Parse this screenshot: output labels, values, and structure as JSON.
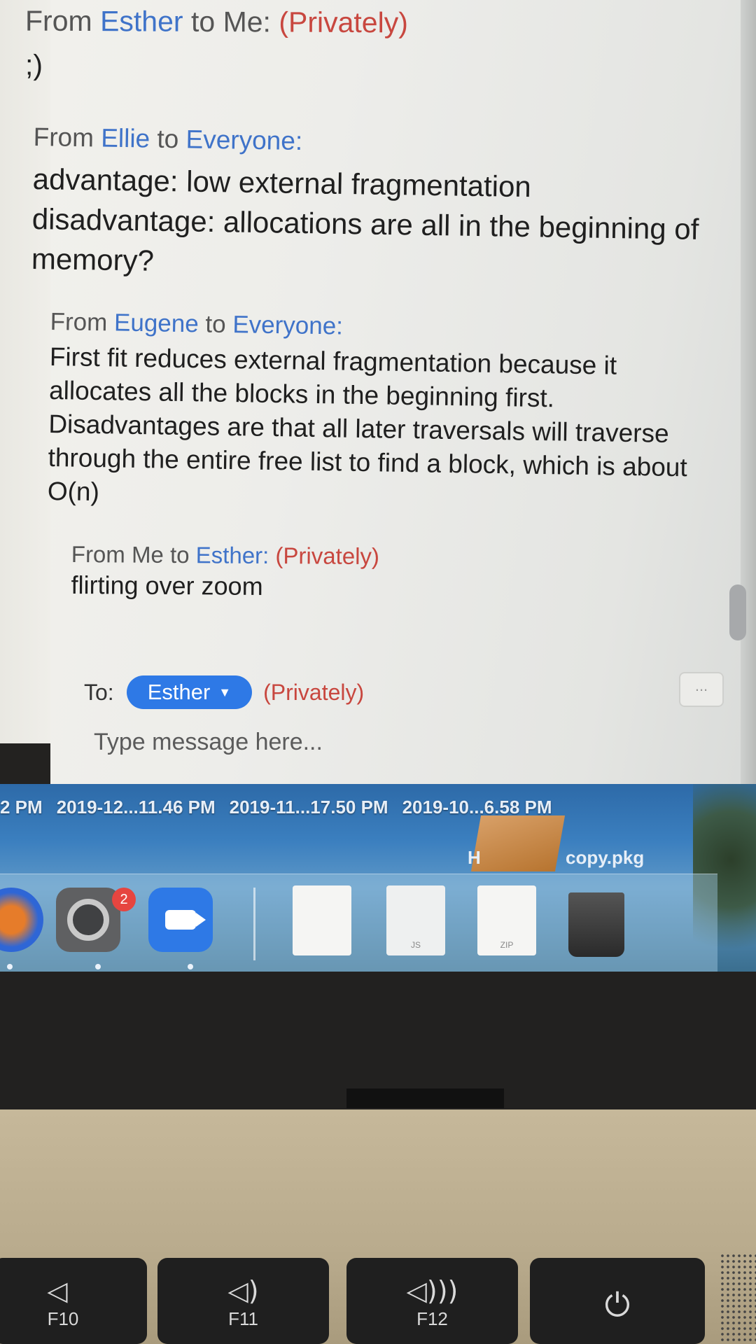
{
  "chat": {
    "messages": [
      {
        "prefix": "From",
        "from": "Esther",
        "mid": "to",
        "to": "Me:",
        "private": "(Privately)",
        "body": ";)"
      },
      {
        "prefix": "From",
        "from": "Ellie",
        "mid": "to",
        "to": "Everyone:",
        "private": "",
        "body": "advantage: low external fragmentation\ndisadvantage: allocations are all in the beginning of memory?"
      },
      {
        "prefix": "From",
        "from": "Eugene",
        "mid": "to",
        "to": "Everyone:",
        "private": "",
        "body": "First fit reduces external fragmentation because it allocates all the blocks in the beginning first. Disadvantages are that all later traversals will traverse through the entire free list to find a block, which is about O(n)"
      },
      {
        "prefix": "From Me",
        "from": "",
        "mid": "to",
        "to": "Esther:",
        "private": "(Privately)",
        "body": "flirting over zoom"
      }
    ],
    "composer": {
      "to_label": "To:",
      "recipient": "Esther",
      "private_label": "(Privately)",
      "placeholder": "Type message here...",
      "more_label": "..."
    }
  },
  "desktop": {
    "file_labels": [
      "2 PM",
      "2019-12...11.46 PM",
      "2019-11...17.50 PM",
      "2019-10...6.58 PM"
    ],
    "pkg_label": "copy.pkg",
    "partial_label": "H"
  },
  "dock": {
    "badge_count": "2",
    "doc_tags": [
      "",
      "JS",
      "ZIP"
    ]
  },
  "keyboard": {
    "keys": [
      {
        "label": "F10",
        "icon": "volume-mute-icon"
      },
      {
        "label": "F11",
        "icon": "volume-down-icon"
      },
      {
        "label": "F12",
        "icon": "volume-up-icon"
      },
      {
        "label": "",
        "icon": "power-icon"
      }
    ]
  },
  "colors": {
    "name_blue": "#3f73c9",
    "private_red": "#c8473f",
    "zoom_blue": "#2e79e6"
  }
}
